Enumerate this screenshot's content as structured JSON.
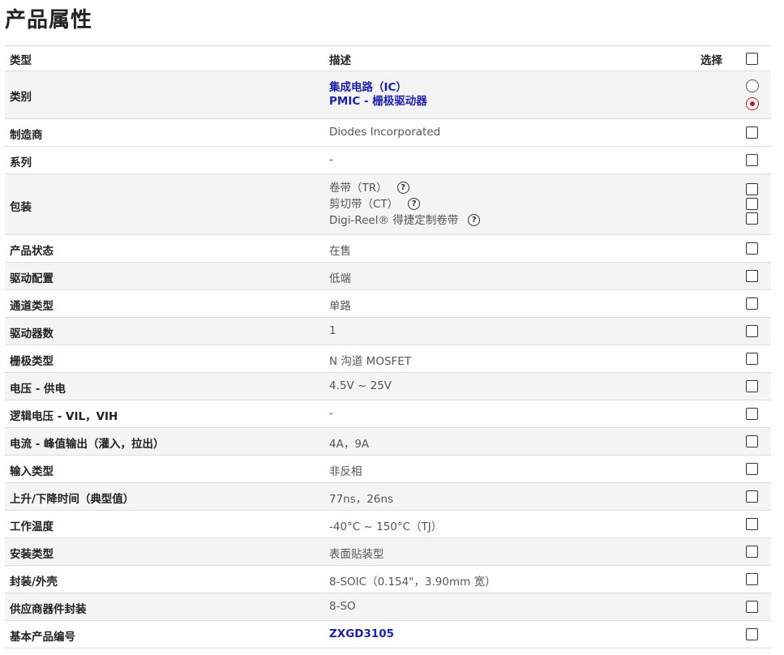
{
  "page_title": "产品属性",
  "header": {
    "col_type": "类型",
    "col_desc": "描述",
    "col_select": "选择"
  },
  "category": {
    "label": "类别",
    "links": [
      "集成电路（IC）",
      "PMIC - 栅极驱动器"
    ]
  },
  "manufacturer": {
    "label": "制造商",
    "value": "Diodes Incorporated"
  },
  "series": {
    "label": "系列",
    "value": "-"
  },
  "packaging": {
    "label": "包装",
    "options": [
      "卷带（TR）",
      "剪切带（CT）",
      "Digi-Reel® 得捷定制卷带"
    ],
    "help_glyph": "?"
  },
  "rows": [
    {
      "label": "产品状态",
      "value": "在售"
    },
    {
      "label": "驱动配置",
      "value": "低端"
    },
    {
      "label": "通道类型",
      "value": "单路"
    },
    {
      "label": "驱动器数",
      "value": "1"
    },
    {
      "label": "栅极类型",
      "value": "N 沟道 MOSFET"
    },
    {
      "label": "电压 - 供电",
      "value": "4.5V ~ 25V"
    },
    {
      "label": "逻辑电压 - VIL，VIH",
      "value": "-"
    },
    {
      "label": "电流 - 峰值输出（灌入，拉出）",
      "value": "4A，9A"
    },
    {
      "label": "输入类型",
      "value": "非反相"
    },
    {
      "label": "上升/下降时间（典型值）",
      "value": "77ns，26ns"
    },
    {
      "label": "工作温度",
      "value": "-40°C ~ 150°C（TJ）"
    },
    {
      "label": "安装类型",
      "value": "表面贴装型"
    },
    {
      "label": "封装/外壳",
      "value": "8-SOIC（0.154\"，3.90mm 宽）"
    },
    {
      "label": "供应商器件封装",
      "value": "8-SO"
    },
    {
      "label": "基本产品编号",
      "value": "ZXGD3105"
    }
  ],
  "colors": {
    "link": "#1e22aa",
    "radio_selected": "#c8102e",
    "alt_row": "#f4f4f4"
  }
}
